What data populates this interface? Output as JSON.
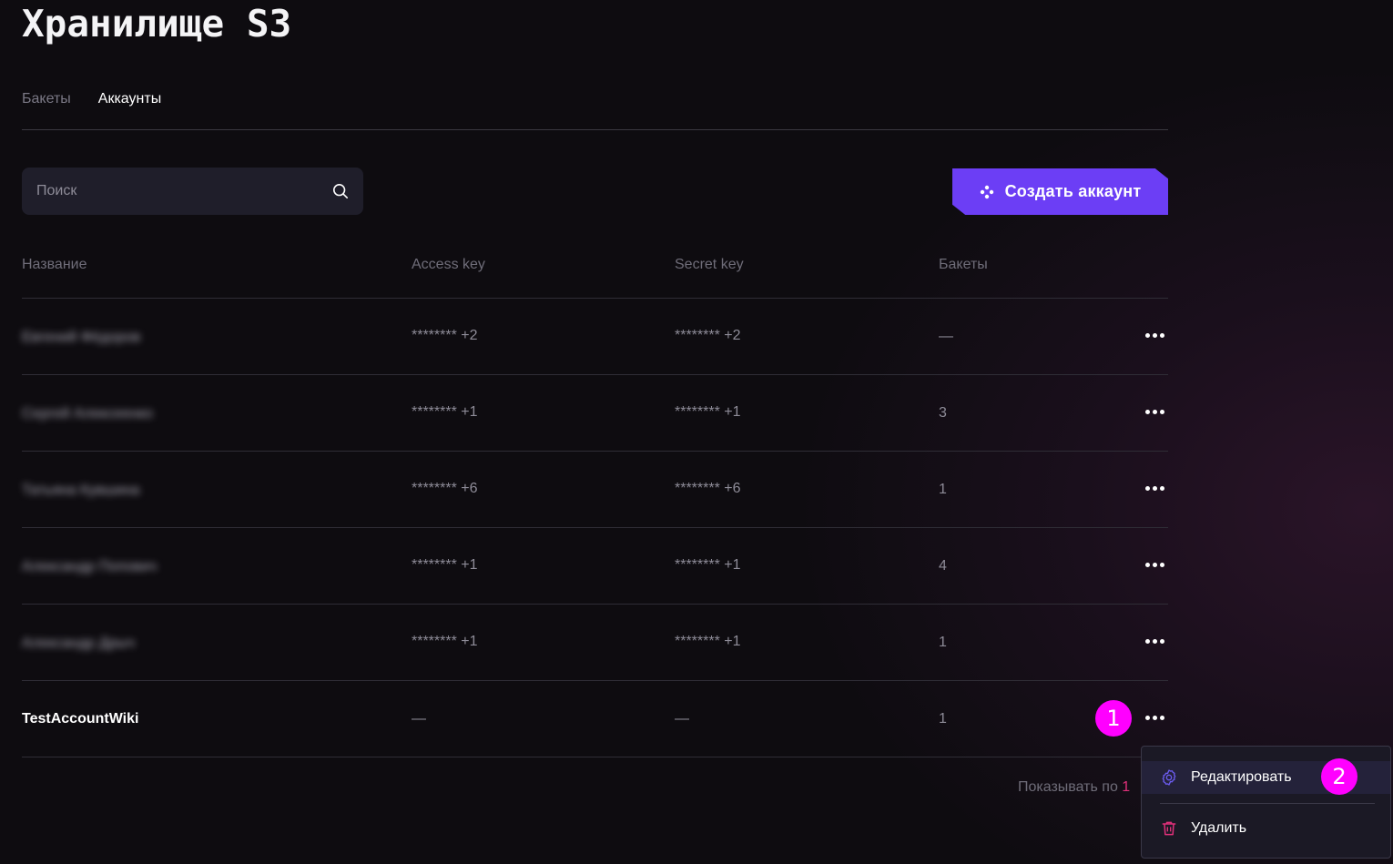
{
  "page": {
    "title": "Хранилище S3"
  },
  "tabs": [
    {
      "label": "Бакеты",
      "active": false
    },
    {
      "label": "Аккаунты",
      "active": true
    }
  ],
  "search": {
    "placeholder": "Поиск",
    "value": "",
    "icon": "search-icon"
  },
  "actions": {
    "create_label": "Создать аккаунт",
    "create_icon": "sparkle-icon"
  },
  "table": {
    "columns": [
      "Название",
      "Access key",
      "Secret key",
      "Бакеты"
    ],
    "rows": [
      {
        "name": "Евгений Фёдоров",
        "access_key": "********",
        "access_extra": "+2",
        "secret_key": "********",
        "secret_extra": "+2",
        "buckets": "—",
        "blurred": true
      },
      {
        "name": "Сергей Алексеенко",
        "access_key": "********",
        "access_extra": "+1",
        "secret_key": "********",
        "secret_extra": "+1",
        "buckets": "3",
        "blurred": true
      },
      {
        "name": "Татьяна Кувшина",
        "access_key": "********",
        "access_extra": "+6",
        "secret_key": "********",
        "secret_extra": "+6",
        "buckets": "1",
        "blurred": true
      },
      {
        "name": "Александр Попович",
        "access_key": "********",
        "access_extra": "+1",
        "secret_key": "********",
        "secret_extra": "+1",
        "buckets": "4",
        "blurred": true
      },
      {
        "name": "Александр Дрыч",
        "access_key": "********",
        "access_extra": "+1",
        "secret_key": "********",
        "secret_extra": "+1",
        "buckets": "1",
        "blurred": true
      },
      {
        "name": "TestAccountWiki",
        "access_key": "—",
        "access_extra": "",
        "secret_key": "—",
        "secret_extra": "",
        "buckets": "1",
        "blurred": false
      }
    ]
  },
  "pagination": {
    "label": "Показывать по",
    "value": "1"
  },
  "context_menu": {
    "items": [
      {
        "label": "Редактировать",
        "icon": "gear-icon"
      },
      {
        "label": "Удалить",
        "icon": "trash-icon"
      }
    ]
  },
  "annotations": {
    "marker_1": "1",
    "marker_2": "2"
  },
  "colors": {
    "accent": "#6c3ef5",
    "marker": "#ff00ff",
    "danger": "#e0307a",
    "background": "#0e0c10"
  }
}
